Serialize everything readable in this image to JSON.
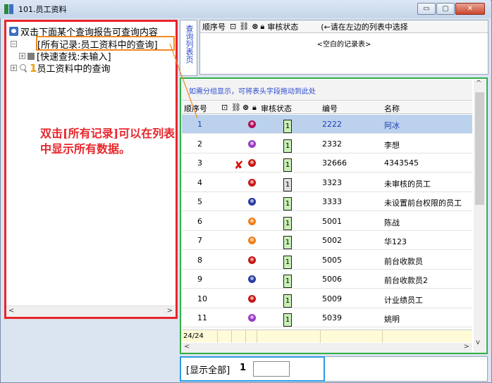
{
  "window": {
    "title": "101.员工资料",
    "minimize_label": "▭",
    "maximize_label": "▢",
    "close_label": "✕"
  },
  "tree": {
    "root_label": "双击下面某个查询报告可查询内容",
    "all_records_label": "[所有记录:员工资料中的查询]",
    "quick_search_label": "[快速查找:未输入]",
    "query_number": "1",
    "query_label": "员工资料中的查询"
  },
  "annotation": "双击[所有记录]可以在列表中显示所有数据。",
  "vertical_tab_label": "查询列表页",
  "top_grid": {
    "col_seq": "顺序号",
    "col_status": "审核状态",
    "hint": "(←请在左边的列表中选择",
    "empty_text": "<空白的记录表>"
  },
  "main_grid": {
    "group_hint": "如需分组显示，可将表头字段拖动到此处",
    "columns": {
      "seq": "顺序号",
      "status": "审核状态",
      "number": "编号",
      "name": "名称"
    },
    "rows": [
      {
        "seq": "1",
        "status": "1",
        "number": "2222",
        "name": "阿冰",
        "color": "#b0105a",
        "selected": true
      },
      {
        "seq": "2",
        "status": "1",
        "number": "2332",
        "name": "李想",
        "color": "#9a3cc4",
        "selected": false
      },
      {
        "seq": "3",
        "status": "1",
        "number": "32666",
        "name": "4343545",
        "color": "#c81818",
        "selected": false,
        "marked": "✘"
      },
      {
        "seq": "4",
        "status": "1",
        "number": "3323",
        "name": "未审核的员工",
        "color": "#c81818",
        "selected": false,
        "gray": true
      },
      {
        "seq": "5",
        "status": "1",
        "number": "3333",
        "name": "未设置前台权限的员工",
        "color": "#2a3ca0",
        "selected": false
      },
      {
        "seq": "6",
        "status": "1",
        "number": "5001",
        "name": "陈战",
        "color": "#f07f1a",
        "selected": false
      },
      {
        "seq": "7",
        "status": "1",
        "number": "5002",
        "name": "华123",
        "color": "#f07f1a",
        "selected": false
      },
      {
        "seq": "8",
        "status": "1",
        "number": "5005",
        "name": "前台收款员",
        "color": "#c81818",
        "selected": false
      },
      {
        "seq": "9",
        "status": "1",
        "number": "5006",
        "name": "前台收款员2",
        "color": "#2a3ca0",
        "selected": false
      },
      {
        "seq": "10",
        "status": "1",
        "number": "5009",
        "name": "计业绩员工",
        "color": "#c81818",
        "selected": false
      },
      {
        "seq": "11",
        "status": "1",
        "number": "5039",
        "name": "姚明",
        "color": "#9a3cc4",
        "selected": false
      }
    ],
    "footer_count": "24/24"
  },
  "bottom": {
    "show_all_label": "[显示全部]",
    "count": "1",
    "page_value": ""
  }
}
